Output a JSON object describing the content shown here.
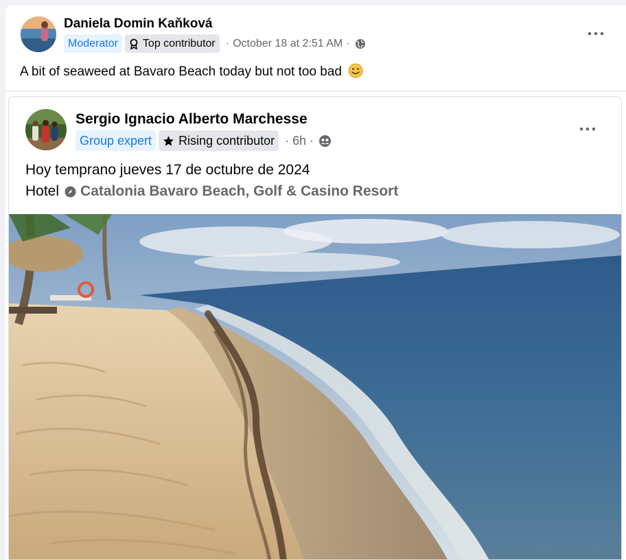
{
  "outer_post": {
    "author": "Daniela Domin Kaňková",
    "badges": [
      "Moderator",
      "Top contributor"
    ],
    "timestamp": "October 18 at 2:51 AM",
    "separator": "·",
    "privacy_icon": "globe-icon",
    "more_icon": "more-horizontal-icon",
    "text": "A bit of seaweed at Bavaro Beach today but not too bad",
    "emoji": "slightly-smiling-face-emoji"
  },
  "shared_post": {
    "author": "Sergio Ignacio Alberto Marchesse",
    "badges": [
      "Group expert",
      "Rising contributor"
    ],
    "timestamp": "6h",
    "separator": "·",
    "privacy_icon": "friends-group-icon",
    "more_icon": "more-horizontal-icon",
    "line1": "Hoy temprano jueves 17 de octubre de 2024",
    "place_prefix": "Hotel",
    "place_icon": "compass-icon",
    "place_name": "Catalonia Bavaro Beach, Golf & Casino Resort",
    "photo_icon": "beach-photo"
  },
  "colors": {
    "accent_blue": "#1877f2",
    "badge_blue_bg": "#e7f3ff",
    "badge_grey_bg": "#e4e6eb",
    "secondary_text": "#65676b",
    "primary_text": "#050505"
  }
}
